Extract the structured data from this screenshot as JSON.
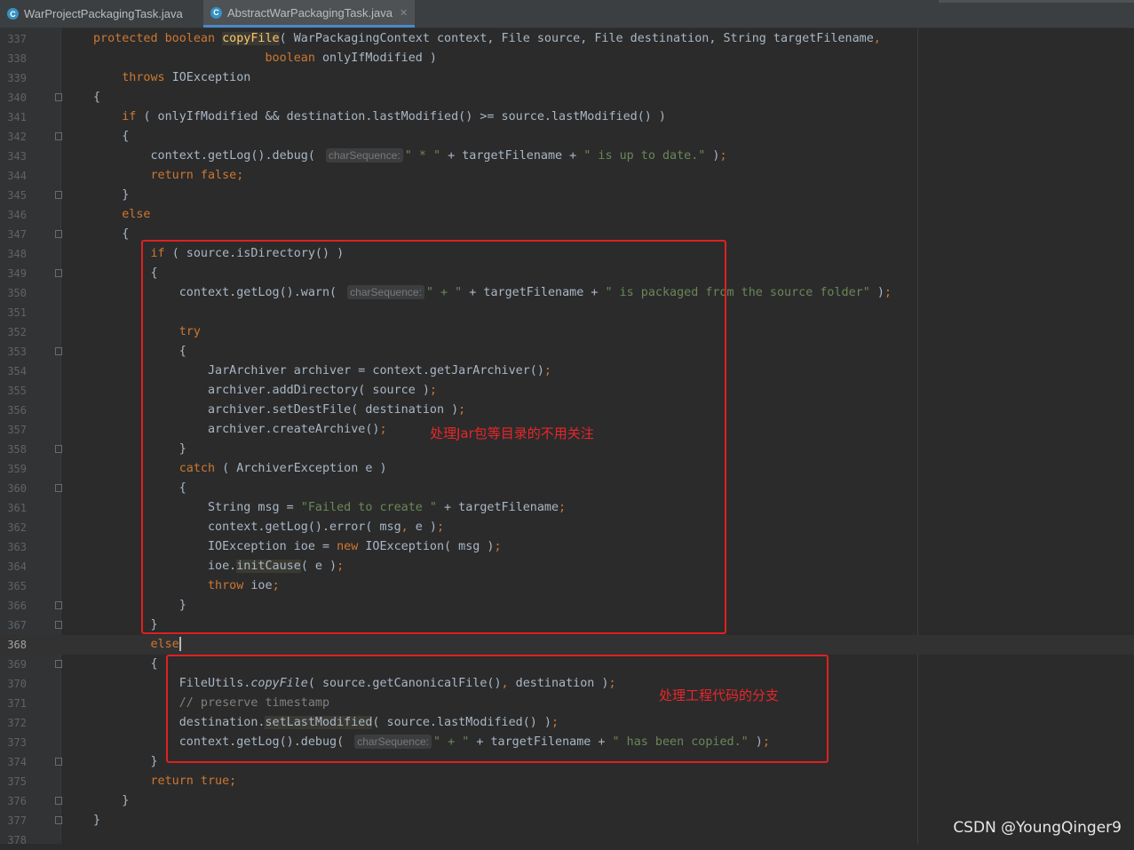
{
  "tabs": [
    {
      "label": "WarProjectPackagingTask.java",
      "icon": "C",
      "active": false
    },
    {
      "label": "AbstractWarPackagingTask.java",
      "icon": "C",
      "active": true
    }
  ],
  "colors": {
    "background": "#2b2b2b",
    "keyword": "#cc7832",
    "string": "#6a8759",
    "comment": "#808080",
    "annotation_box": "#e02020"
  },
  "hint_label": "charSequence:",
  "annotations": {
    "jar_branch_note": "处理Jar包等目录的不用关注",
    "code_branch_note": "处理工程代码的分支"
  },
  "watermark": "CSDN @YoungQinger9",
  "lines": [
    {
      "n": "337",
      "segs": [
        [
          "kw",
          "protected boolean "
        ],
        [
          "hl",
          "copyFile"
        ],
        [
          "",
          "( WarPackagingContext context, File source, File destination, String targetFilename"
        ],
        [
          "kw",
          ","
        ]
      ]
    },
    {
      "n": "338",
      "segs": [
        [
          "",
          "                        "
        ],
        [
          "kw",
          "boolean "
        ],
        [
          "",
          "onlyIfModified )"
        ]
      ]
    },
    {
      "n": "339",
      "segs": [
        [
          "",
          "    "
        ],
        [
          "kw",
          "throws "
        ],
        [
          "",
          "IOException"
        ]
      ]
    },
    {
      "n": "340",
      "segs": [
        [
          "",
          "{"
        ]
      ]
    },
    {
      "n": "341",
      "segs": [
        [
          "",
          "    "
        ],
        [
          "kw",
          "if "
        ],
        [
          "",
          "( onlyIfModified && destination.lastModified() >= source.lastModified() )"
        ]
      ]
    },
    {
      "n": "342",
      "segs": [
        [
          "",
          "    {"
        ]
      ]
    },
    {
      "n": "343",
      "segs": [
        [
          "",
          "        context.getLog().debug( "
        ],
        [
          "hint",
          "charSequence:"
        ],
        [
          "str",
          "\" * \""
        ],
        [
          "",
          " + targetFilename + "
        ],
        [
          "str",
          "\" is up to date.\""
        ],
        [
          "",
          " )"
        ],
        [
          "kw",
          ";"
        ]
      ]
    },
    {
      "n": "344",
      "segs": [
        [
          "",
          "        "
        ],
        [
          "kw",
          "return false;"
        ]
      ]
    },
    {
      "n": "345",
      "segs": [
        [
          "",
          "    }"
        ]
      ]
    },
    {
      "n": "346",
      "segs": [
        [
          "",
          "    "
        ],
        [
          "kw",
          "else"
        ]
      ]
    },
    {
      "n": "347",
      "segs": [
        [
          "",
          "    {"
        ]
      ]
    },
    {
      "n": "348",
      "segs": [
        [
          "",
          "        "
        ],
        [
          "kw",
          "if "
        ],
        [
          "",
          "( source.isDirectory() )"
        ]
      ]
    },
    {
      "n": "349",
      "segs": [
        [
          "",
          "        {"
        ]
      ]
    },
    {
      "n": "350",
      "segs": [
        [
          "",
          "            context.getLog().warn( "
        ],
        [
          "hint",
          "charSequence:"
        ],
        [
          "str",
          "\" + \""
        ],
        [
          "",
          " + targetFilename + "
        ],
        [
          "str",
          "\" is packaged from the source folder\""
        ],
        [
          "",
          " )"
        ],
        [
          "kw",
          ";"
        ]
      ]
    },
    {
      "n": "351",
      "segs": []
    },
    {
      "n": "352",
      "segs": [
        [
          "",
          "            "
        ],
        [
          "kw",
          "try"
        ]
      ]
    },
    {
      "n": "353",
      "segs": [
        [
          "",
          "            {"
        ]
      ]
    },
    {
      "n": "354",
      "segs": [
        [
          "",
          "                JarArchiver archiver = context.getJarArchiver()"
        ],
        [
          "kw",
          ";"
        ]
      ]
    },
    {
      "n": "355",
      "segs": [
        [
          "",
          "                archiver.addDirectory( source )"
        ],
        [
          "kw",
          ";"
        ]
      ]
    },
    {
      "n": "356",
      "segs": [
        [
          "",
          "                archiver.setDestFile( destination )"
        ],
        [
          "kw",
          ";"
        ]
      ]
    },
    {
      "n": "357",
      "segs": [
        [
          "",
          "                archiver.createArchive()"
        ],
        [
          "kw",
          ";"
        ]
      ]
    },
    {
      "n": "358",
      "segs": [
        [
          "",
          "            }"
        ]
      ]
    },
    {
      "n": "359",
      "segs": [
        [
          "",
          "            "
        ],
        [
          "kw",
          "catch "
        ],
        [
          "",
          "( ArchiverException e )"
        ]
      ]
    },
    {
      "n": "360",
      "segs": [
        [
          "",
          "            {"
        ]
      ]
    },
    {
      "n": "361",
      "segs": [
        [
          "",
          "                String msg = "
        ],
        [
          "str",
          "\"Failed to create \""
        ],
        [
          "",
          " + targetFilename"
        ],
        [
          "kw",
          ";"
        ]
      ]
    },
    {
      "n": "362",
      "segs": [
        [
          "",
          "                context.getLog().error( msg"
        ],
        [
          "kw",
          ", "
        ],
        [
          "",
          "e )"
        ],
        [
          "kw",
          ";"
        ]
      ]
    },
    {
      "n": "363",
      "segs": [
        [
          "",
          "                IOException ioe = "
        ],
        [
          "kw",
          "new "
        ],
        [
          "",
          "IOException( msg )"
        ],
        [
          "kw",
          ";"
        ]
      ]
    },
    {
      "n": "364",
      "segs": [
        [
          "",
          "                ioe."
        ],
        [
          "hlm",
          "initCause"
        ],
        [
          "",
          "( e )"
        ],
        [
          "kw",
          ";"
        ]
      ]
    },
    {
      "n": "365",
      "segs": [
        [
          "",
          "                "
        ],
        [
          "kw",
          "throw "
        ],
        [
          "",
          "ioe"
        ],
        [
          "kw",
          ";"
        ]
      ]
    },
    {
      "n": "366",
      "segs": [
        [
          "",
          "            }"
        ]
      ]
    },
    {
      "n": "367",
      "segs": [
        [
          "",
          "        }"
        ]
      ]
    },
    {
      "n": "368",
      "segs": [
        [
          "",
          "        "
        ],
        [
          "kw",
          "else"
        ],
        [
          "caret",
          ""
        ]
      ],
      "current": true
    },
    {
      "n": "369",
      "segs": [
        [
          "",
          "        {"
        ]
      ]
    },
    {
      "n": "370",
      "segs": [
        [
          "",
          "            FileUtils."
        ],
        [
          "it",
          "copyFile"
        ],
        [
          "",
          "( source.getCanonicalFile()"
        ],
        [
          "kw",
          ", "
        ],
        [
          "",
          "destination )"
        ],
        [
          "kw",
          ";"
        ]
      ]
    },
    {
      "n": "371",
      "segs": [
        [
          "",
          "            "
        ],
        [
          "cmt",
          "// preserve timestamp"
        ]
      ]
    },
    {
      "n": "372",
      "segs": [
        [
          "",
          "            destination."
        ],
        [
          "hlm",
          "setLastModified"
        ],
        [
          "",
          "( source.lastModified() )"
        ],
        [
          "kw",
          ";"
        ]
      ]
    },
    {
      "n": "373",
      "segs": [
        [
          "",
          "            context.getLog().debug( "
        ],
        [
          "hint",
          "charSequence:"
        ],
        [
          "str",
          "\" + \""
        ],
        [
          "",
          " + targetFilename + "
        ],
        [
          "str",
          "\" has been copied.\""
        ],
        [
          "",
          " )"
        ],
        [
          "kw",
          ";"
        ]
      ]
    },
    {
      "n": "374",
      "segs": [
        [
          "",
          "        }"
        ]
      ]
    },
    {
      "n": "375",
      "segs": [
        [
          "",
          "        "
        ],
        [
          "kw",
          "return true;"
        ]
      ]
    },
    {
      "n": "376",
      "segs": [
        [
          "",
          "    }"
        ]
      ]
    },
    {
      "n": "377",
      "segs": [
        [
          "",
          "}"
        ]
      ]
    },
    {
      "n": "378",
      "segs": []
    }
  ]
}
